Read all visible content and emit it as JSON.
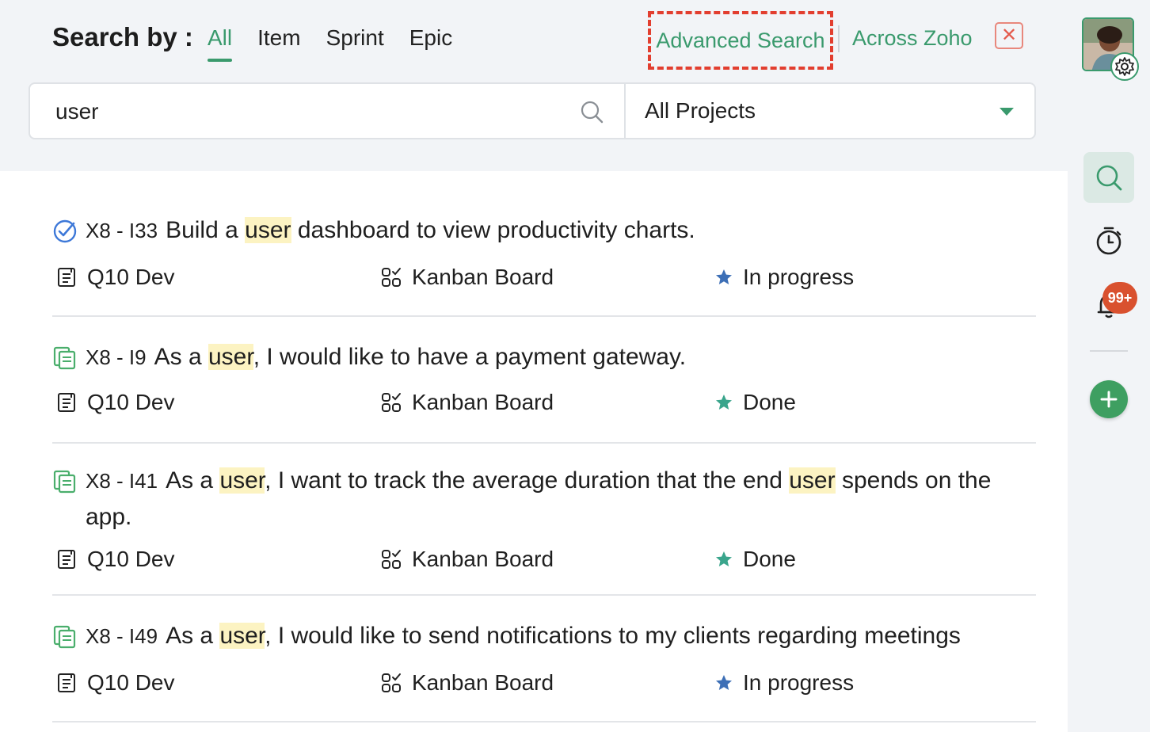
{
  "header": {
    "search_by_label": "Search by :",
    "tabs": [
      {
        "label": "All",
        "active": true
      },
      {
        "label": "Item",
        "active": false
      },
      {
        "label": "Sprint",
        "active": false
      },
      {
        "label": "Epic",
        "active": false
      }
    ],
    "advanced_search_label": "Advanced Search",
    "across_zoho_label": "Across Zoho",
    "close_icon": "close-icon"
  },
  "search": {
    "value": "user",
    "icon": "search-icon",
    "project_filter": "All Projects"
  },
  "results": [
    {
      "id": "X8 - I33",
      "type_icon": "task-check-icon",
      "title_parts": [
        {
          "text": "Build a "
        },
        {
          "text": "user",
          "highlight": true
        },
        {
          "text": " dashboard to view productivity charts."
        }
      ],
      "project": "Q10 Dev",
      "board": "Kanban Board",
      "status": "In progress",
      "status_color": "#3d6fb6"
    },
    {
      "id": "X8 - I9",
      "type_icon": "story-icon",
      "title_parts": [
        {
          "text": "As a "
        },
        {
          "text": "user",
          "highlight": true
        },
        {
          "text": ", I would like to have a payment gateway."
        }
      ],
      "project": "Q10 Dev",
      "board": "Kanban Board",
      "status": "Done",
      "status_color": "#3aa58c"
    },
    {
      "id": "X8 - I41",
      "type_icon": "story-icon",
      "title_parts": [
        {
          "text": "As a "
        },
        {
          "text": "user",
          "highlight": true
        },
        {
          "text": ", I want to track the average duration that the end "
        },
        {
          "text": "user",
          "highlight": true
        },
        {
          "text": " spends on the app."
        }
      ],
      "project": "Q10 Dev",
      "board": "Kanban Board",
      "status": "Done",
      "status_color": "#3aa58c"
    },
    {
      "id": "X8 - I49",
      "type_icon": "story-icon",
      "title_parts": [
        {
          "text": "As a "
        },
        {
          "text": "user",
          "highlight": true
        },
        {
          "text": ", I would like to send notifications to my clients regarding meetings"
        }
      ],
      "project": "Q10 Dev",
      "board": "Kanban Board",
      "status": "In progress",
      "status_color": "#3d6fb6"
    }
  ],
  "rail": {
    "notification_badge": "99+",
    "icons": [
      "avatar",
      "gear-icon",
      "search-icon",
      "timer-icon",
      "bell-icon",
      "add-icon"
    ]
  },
  "colors": {
    "accent": "#3a9a6d",
    "highlight_bg": "#fcf3c2",
    "dashed_border": "#e23e2f"
  }
}
